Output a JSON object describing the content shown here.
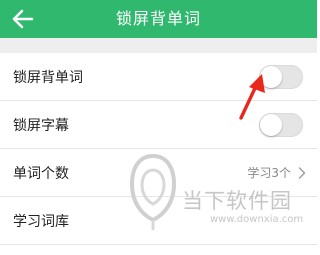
{
  "header": {
    "title": "锁屏背单词",
    "back_icon": "arrow-left-icon",
    "color": "#2fb86e"
  },
  "settings": [
    {
      "label": "锁屏背单词",
      "control": "toggle",
      "on": false
    },
    {
      "label": "锁屏字幕",
      "control": "toggle",
      "on": false
    },
    {
      "label": "单词个数",
      "value": "学习3个",
      "control": "chevron"
    },
    {
      "label": "学习词库",
      "control": "none"
    }
  ],
  "annotation": {
    "icon": "red-pointer-arrow-icon",
    "color": "#e8271d"
  },
  "watermark": {
    "text": "当下软件园",
    "url": "www.downxia.com"
  }
}
